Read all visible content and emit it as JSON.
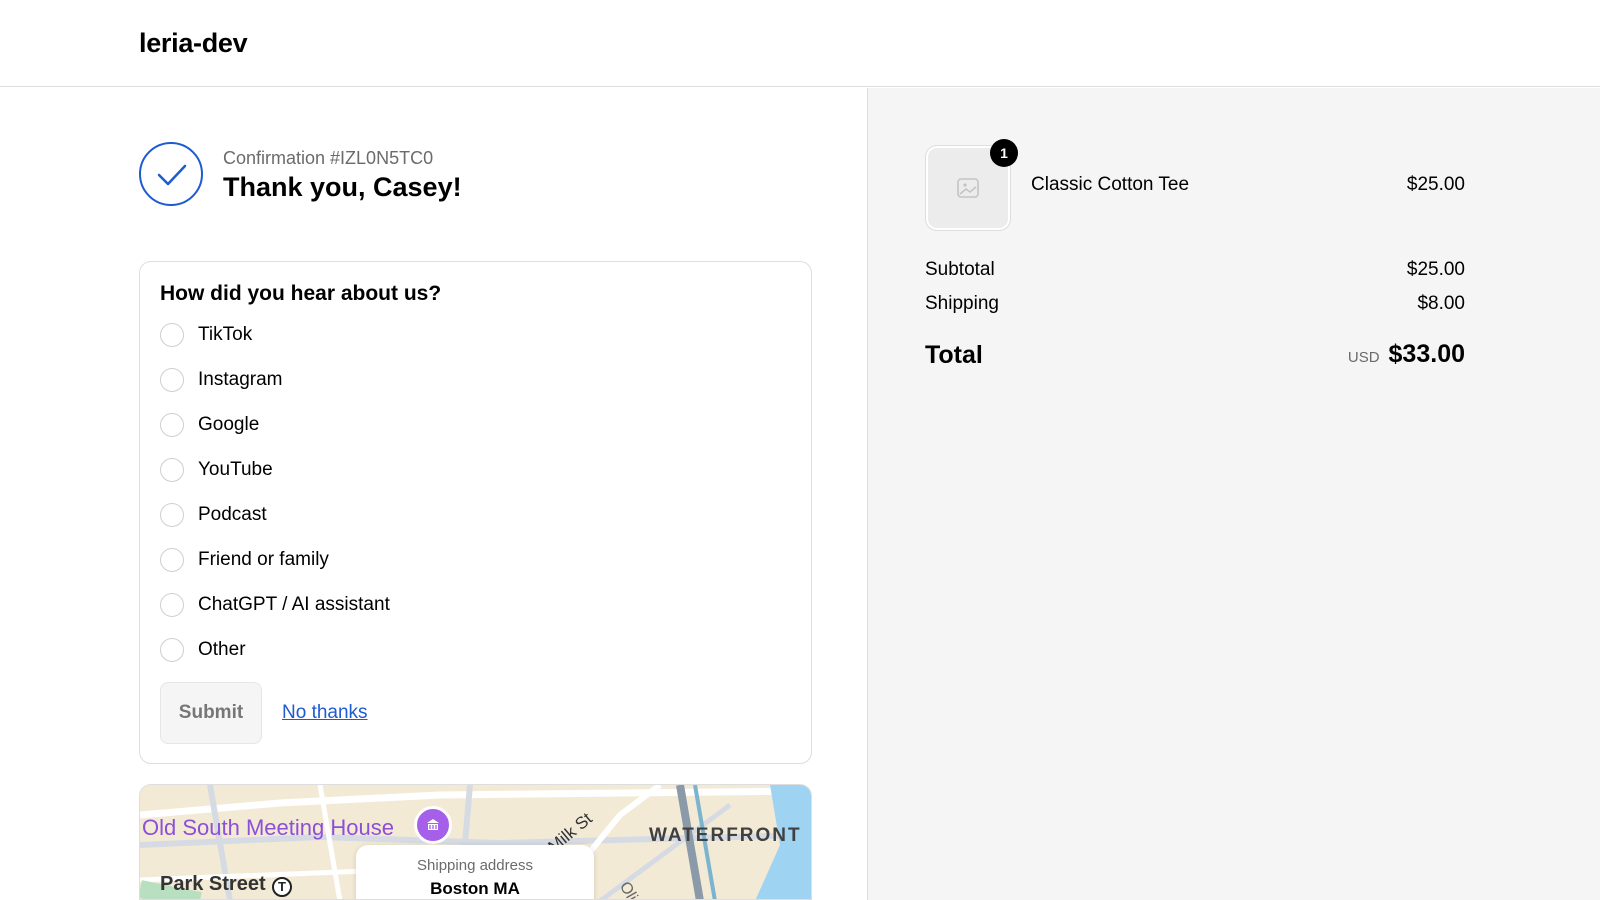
{
  "header": {
    "brand": "leria-dev"
  },
  "confirmation": {
    "number_text": "Confirmation #IZL0N5TC0",
    "thanks": "Thank you, Casey!"
  },
  "survey": {
    "title": "How did you hear about us?",
    "options": [
      "TikTok",
      "Instagram",
      "Google",
      "YouTube",
      "Podcast",
      "Friend or family",
      "ChatGPT / AI assistant",
      "Other"
    ],
    "submit_label": "Submit",
    "no_thanks_label": "No thanks"
  },
  "map": {
    "labels": {
      "meeting_house": "Old South Meeting House",
      "park_street": "Park Street",
      "waterfront": "WATERFRONT",
      "milk_st": "Milk St",
      "oli": "Oli"
    },
    "shipping_card": {
      "label": "Shipping address",
      "city": "Boston MA"
    }
  },
  "order": {
    "item": {
      "name": "Classic Cotton Tee",
      "price": "$25.00",
      "quantity": "1"
    },
    "subtotal_label": "Subtotal",
    "subtotal": "$25.00",
    "shipping_label": "Shipping",
    "shipping": "$8.00",
    "total_label": "Total",
    "currency": "USD",
    "total": "$33.00"
  },
  "colors": {
    "accent": "#1d5bd1",
    "map_poi": "#8d4fd8",
    "summary_bg": "#f5f5f5"
  },
  "icons": [
    "check-icon",
    "image-placeholder-icon",
    "museum-icon",
    "transit-icon"
  ]
}
